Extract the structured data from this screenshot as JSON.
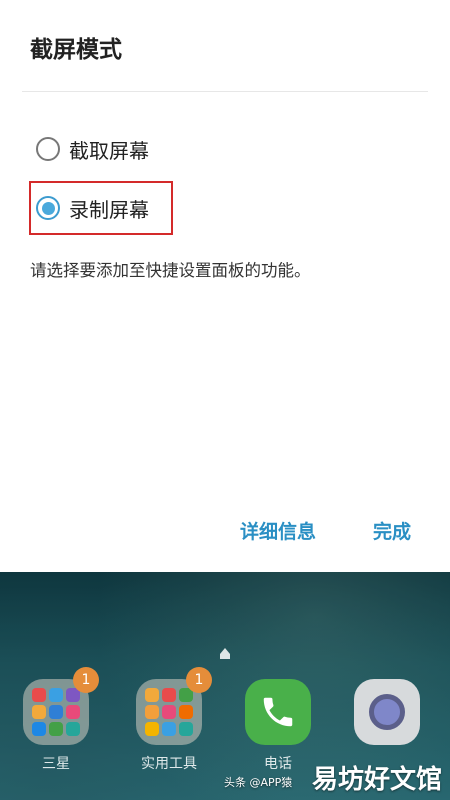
{
  "dialog": {
    "title": "截屏模式",
    "options": [
      {
        "label": "截取屏幕",
        "selected": false
      },
      {
        "label": "录制屏幕",
        "selected": true
      }
    ],
    "description": "请选择要添加至快捷设置面板的功能。",
    "buttons": {
      "details": "详细信息",
      "done": "完成"
    }
  },
  "home": {
    "apps": [
      {
        "name": "三星",
        "badge": "1"
      },
      {
        "name": "实用工具",
        "badge": "1"
      },
      {
        "name": "电话"
      },
      {
        "name": ""
      }
    ]
  },
  "watermark": {
    "main": "易坊好文馆",
    "sub": "头条 @APP猿"
  },
  "colors": {
    "accent": "#2a8fc4",
    "radio_selected": "#4aa9dc",
    "highlight": "#d42a2a",
    "badge": "#e58d3a"
  }
}
